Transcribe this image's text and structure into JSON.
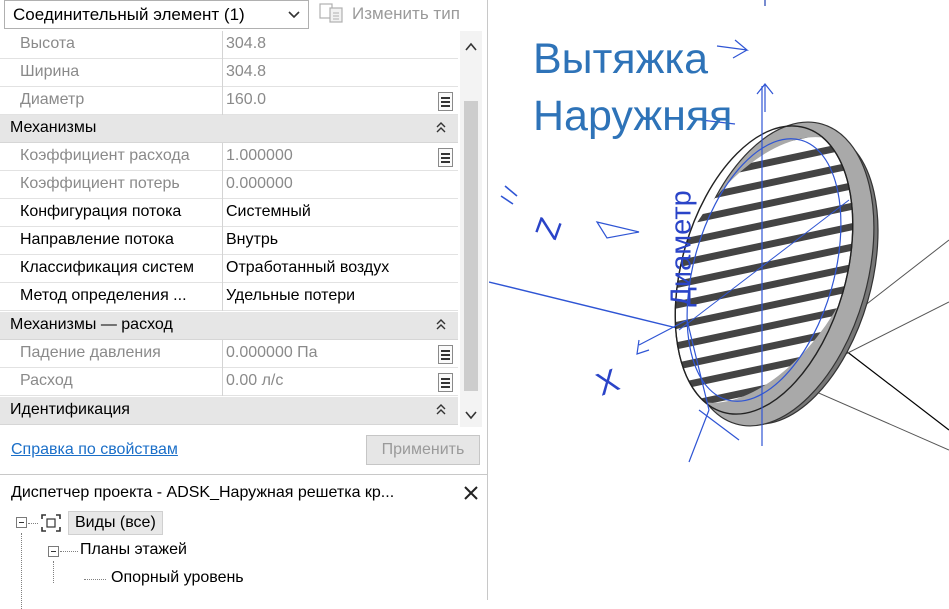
{
  "properties": {
    "type_selector": "Соединительный элемент (1)",
    "edit_type_label": "Изменить тип",
    "rows": [
      {
        "name": "Высота",
        "value": "304.8"
      },
      {
        "name": "Ширина",
        "value": "304.8"
      },
      {
        "name": "Диаметр",
        "value": "160.0"
      }
    ],
    "groups": [
      {
        "label": "Механизмы",
        "rows": [
          {
            "name": "Коэффициент расхода",
            "value": "1.000000"
          },
          {
            "name": "Коэффициент потерь",
            "value": "0.000000"
          },
          {
            "name": "Конфигурация потока",
            "value": "Системный"
          },
          {
            "name": "Направление потока",
            "value": "Внутрь"
          },
          {
            "name": "Классификация систем",
            "value": "Отработанный воздух"
          },
          {
            "name": "Метод определения ...",
            "value": "Удельные потери"
          }
        ]
      },
      {
        "label": "Механизмы — расход",
        "rows": [
          {
            "name": "Падение давления",
            "value": "0.000000 Па"
          },
          {
            "name": "Расход",
            "value": "0.00 л/с"
          }
        ]
      },
      {
        "label": "Идентификация",
        "rows": []
      }
    ],
    "help_link": "Справка по свойствам",
    "apply_button": "Применить"
  },
  "project_browser": {
    "title": "Диспетчер проекта - ADSK_Наружная решетка кр...",
    "tree": [
      {
        "label": "Виды (все)",
        "level": 0,
        "expanded": true
      },
      {
        "label": "Планы этажей",
        "level": 1,
        "expanded": true
      },
      {
        "label": "Опорный уровень",
        "level": 2
      }
    ]
  },
  "viewport": {
    "title_line1": "Вытяжка",
    "title_line2": "Наружняя",
    "dimension_label": "Диаметр",
    "axis_z": "Z",
    "axis_x": "X"
  },
  "colors": {
    "annotation_blue": "#2e73b8",
    "link_blue": "#1b6fc8",
    "group_header_bg": "#e6e6e6"
  }
}
